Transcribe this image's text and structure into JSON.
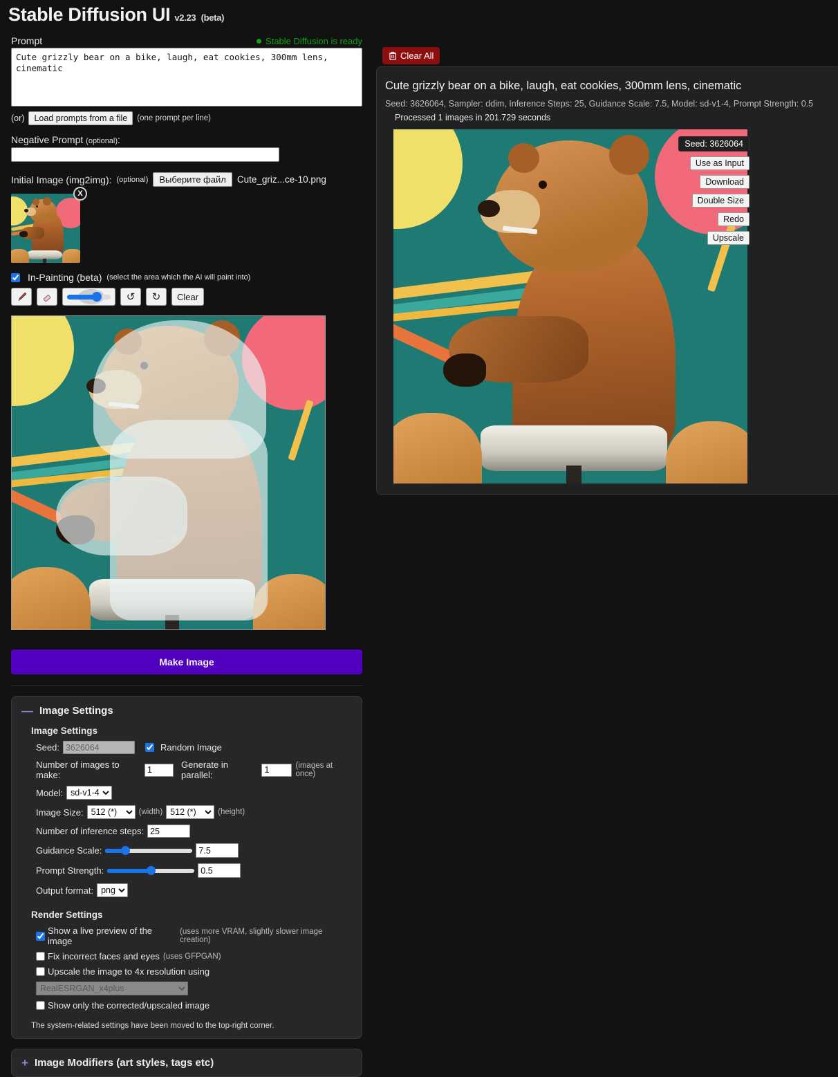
{
  "app": {
    "title": "Stable Diffusion UI",
    "version": "v2.23",
    "beta_tag": "(beta)"
  },
  "prompt_section": {
    "label": "Prompt",
    "status_text": "Stable Diffusion is ready",
    "status_color": "#15a015",
    "prompt_value": "Cute grizzly bear on a bike, laugh, eat cookies, 300mm lens, cinematic",
    "or_text": "(or)",
    "load_button": "Load prompts from a file",
    "load_hint": "(one prompt per line)"
  },
  "negative_prompt": {
    "label": "Negative Prompt",
    "optional_tag": "(optional)",
    "value": "",
    "placeholder": ""
  },
  "initial_image": {
    "label": "Initial Image (img2img):",
    "optional_tag": "(optional)",
    "file_button": "Выберите файл",
    "file_name": "Cute_griz...ce-10.png",
    "remove_label": "X"
  },
  "inpainting": {
    "label": "In-Painting (beta)",
    "hint": "(select the area which the AI will paint into)",
    "checked": true,
    "tools": [
      {
        "name": "brush-tool",
        "glyph": "🖌"
      },
      {
        "name": "eraser-tool",
        "glyph": "🧽"
      },
      {
        "name": "undo-tool",
        "glyph": "↺"
      },
      {
        "name": "redo-tool",
        "glyph": "↻"
      }
    ],
    "clear_button": "Clear",
    "brush_size_percent": 58
  },
  "make_button": {
    "label": "Make Image",
    "color": "#5000be"
  },
  "image_settings": {
    "panel_title": "Image Settings",
    "collapse_sign": "—",
    "section_title": "Image Settings",
    "seed_label": "Seed:",
    "seed_value": "3626064",
    "seed_disabled": true,
    "random_image_label": "Random Image",
    "random_image_checked": true,
    "num_images_label": "Number of images to make:",
    "num_images_value": "1",
    "parallel_label": "Generate in parallel:",
    "parallel_value": "1",
    "parallel_hint": "(images at once)",
    "model_label": "Model:",
    "model_value": "sd-v1-4",
    "image_size_label": "Image Size:",
    "width_value": "512 (*)",
    "width_hint": "(width)",
    "height_value": "512 (*)",
    "height_hint": "(height)",
    "steps_label": "Number of inference steps:",
    "steps_value": "25",
    "guidance_label": "Guidance Scale:",
    "guidance_value": "7.5",
    "guidance_percent": 23,
    "strength_label": "Prompt Strength:",
    "strength_value": "0.5",
    "strength_percent": 50,
    "output_format_label": "Output format:",
    "output_format_value": "png"
  },
  "render_settings": {
    "title": "Render Settings",
    "options": [
      {
        "label": "Show a live preview of the image",
        "note": "(uses more VRAM, slightly slower image creation)",
        "checked": true
      },
      {
        "label": "Fix incorrect faces and eyes",
        "note": "(uses GFPGAN)",
        "checked": false
      },
      {
        "label": "Upscale the image to 4x resolution using",
        "note": "",
        "checked": false
      },
      {
        "label": "Show only the corrected/upscaled image",
        "note": "",
        "checked": false
      }
    ],
    "upscale_model_value": "RealESRGAN_x4plus",
    "upscale_model_disabled": true,
    "footer_note": "The system-related settings have been moved to the top-right corner."
  },
  "image_modifiers": {
    "title": "Image Modifiers (art styles, tags etc)",
    "expand_sign": "+"
  },
  "results": {
    "clear_all_label": "Clear All",
    "clear_all_icon": "trash-icon",
    "clear_all_color": "#8b0f0f",
    "result_prompt": "Cute grizzly bear on a bike, laugh, eat cookies, 300mm lens, cinematic",
    "result_meta": "Seed: 3626064, Sampler: ddim, Inference Steps: 25, Guidance Scale: 7.5, Model: sd-v1-4, Prompt Strength: 0.5",
    "processed_text": "Processed 1 images in 201.729 seconds",
    "seed_chip": "Seed: 3626064",
    "actions": [
      "Use as Input",
      "Download",
      "Double Size",
      "Redo",
      "Upscale"
    ]
  }
}
